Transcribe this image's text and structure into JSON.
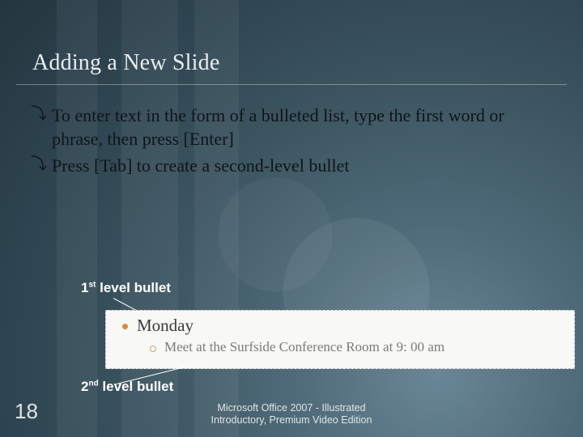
{
  "title": "Adding a New Slide",
  "bullets": [
    "To enter text in the form of a bulleted list, type the first word or phrase, then press [Enter]",
    "Press [Tab] to create a second-level bullet"
  ],
  "callouts": {
    "first": {
      "ordinal": "1",
      "suffix": "st",
      "rest": " level bullet"
    },
    "second": {
      "ordinal": "2",
      "suffix": "nd",
      "rest": " level bullet"
    }
  },
  "example": {
    "level1": "Monday",
    "level2": "Meet at the Surfside Conference Room at 9: 00 am"
  },
  "slide_number": "18",
  "footer": {
    "line1": "Microsoft Office 2007 - Illustrated",
    "line2": "Introductory, Premium Video Edition"
  }
}
